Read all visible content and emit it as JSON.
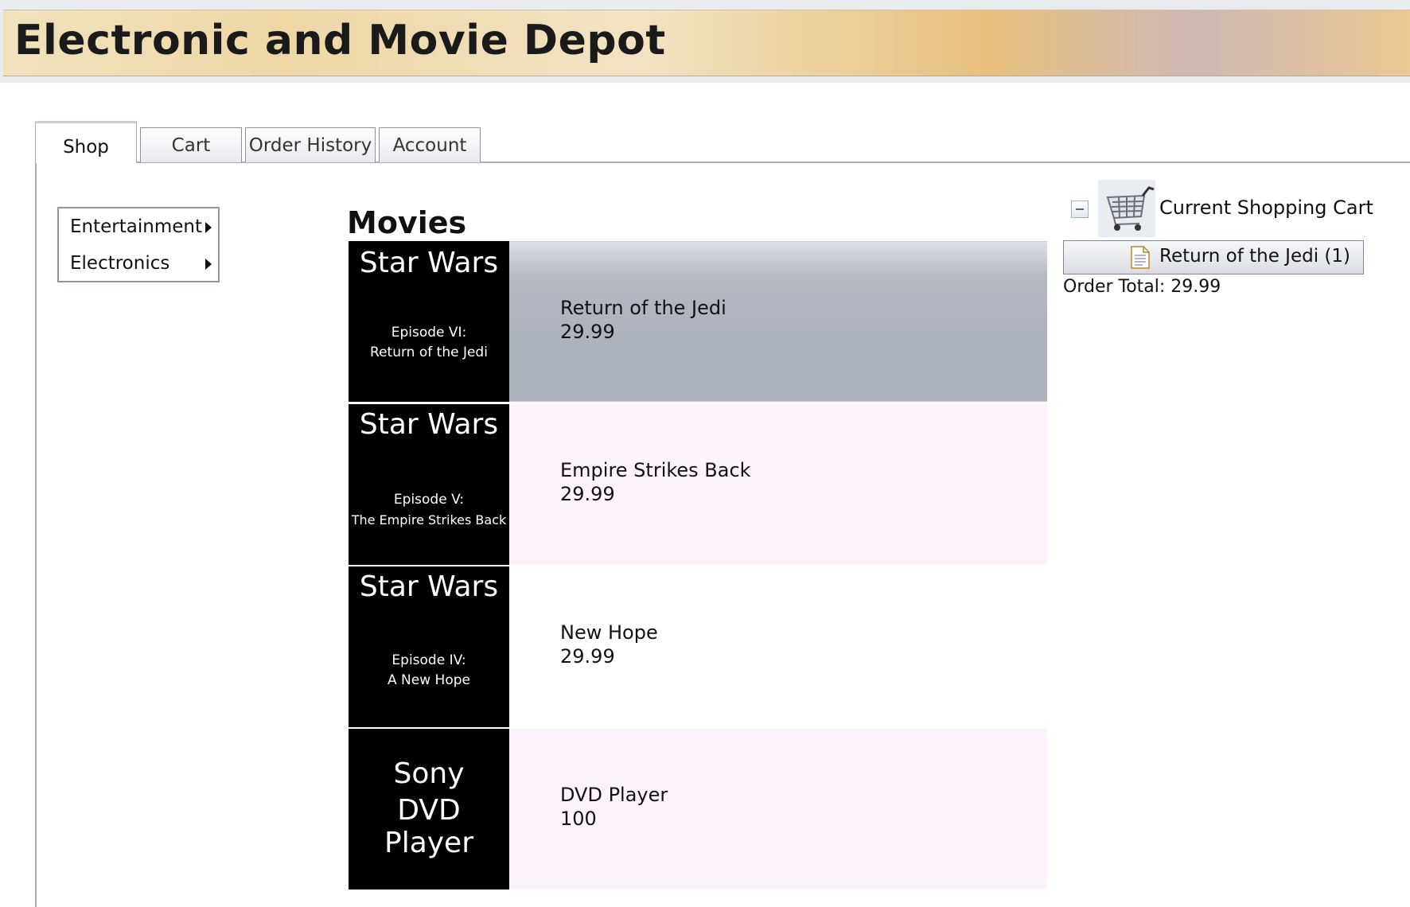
{
  "app": {
    "title": "Electronic and Movie Depot"
  },
  "tabs": [
    {
      "label": "Shop",
      "active": true
    },
    {
      "label": "Cart",
      "active": false
    },
    {
      "label": "Order History",
      "active": false
    },
    {
      "label": "Account",
      "active": false
    }
  ],
  "category_menu": {
    "items": [
      {
        "label": "Entertainment"
      },
      {
        "label": "Electronics"
      }
    ]
  },
  "section": {
    "title": "Movies"
  },
  "products": [
    {
      "thumb_title": "Star Wars",
      "thumb_line1": "Episode VI:",
      "thumb_line2": "Return of the Jedi",
      "name": "Return of the Jedi",
      "price": "29.99",
      "selected": true
    },
    {
      "thumb_title": "Star Wars",
      "thumb_line1": "Episode V:",
      "thumb_line2": "The Empire Strikes Back",
      "name": "Empire Strikes Back",
      "price": "29.99",
      "selected": false
    },
    {
      "thumb_title": "Star Wars",
      "thumb_line1": "Episode IV:",
      "thumb_line2": "A New Hope",
      "name": "New Hope",
      "price": "29.99",
      "selected": false
    },
    {
      "thumb_line1": "Sony",
      "thumb_line2": "DVD Player",
      "name": "DVD Player",
      "price": "100",
      "selected": false
    }
  ],
  "cart": {
    "title": "Current Shopping Cart",
    "items": [
      {
        "label": "Return of the Jedi (1)"
      }
    ],
    "order_total": "Order Total: 29.99"
  },
  "colors": {
    "selected_row": "#adb3bd",
    "alt_row": "#fdf3fd",
    "plain_row": "#ffffff",
    "thumb_bg": "#000000"
  },
  "icons": {
    "submenu": "caret-right-icon",
    "cart": "shopping-cart-icon",
    "collapse": "collapse-minus-icon",
    "cart_item": "document-icon"
  }
}
